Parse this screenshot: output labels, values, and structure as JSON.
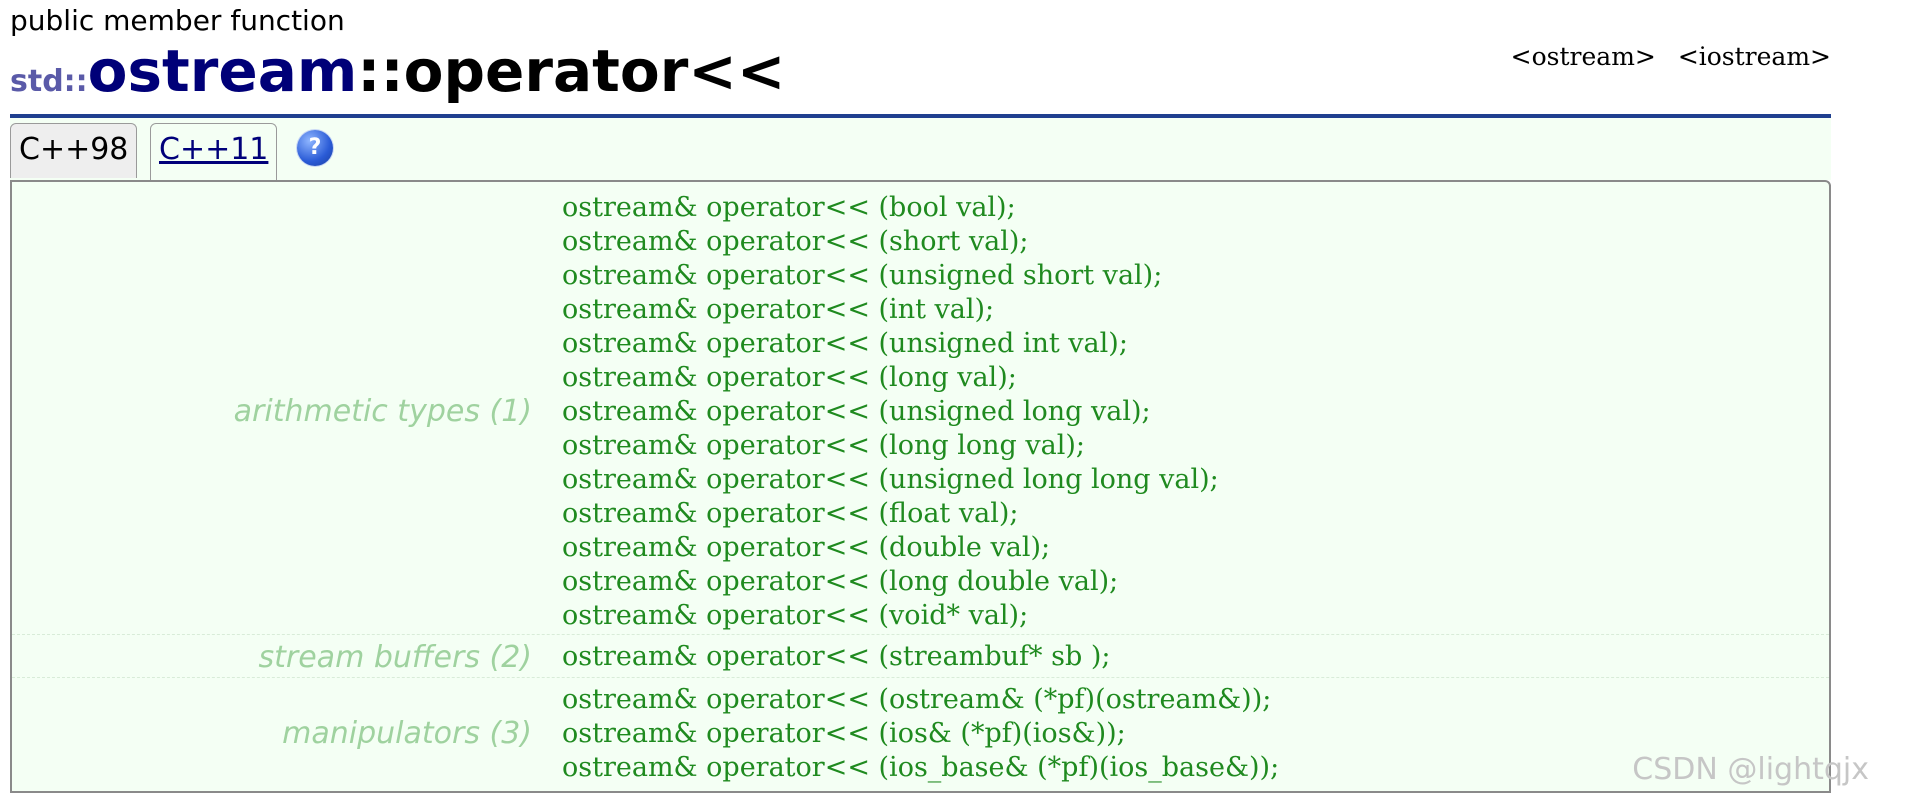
{
  "page": {
    "kind": "public member function",
    "title": {
      "namespace": "std::",
      "class_name": "ostream",
      "separator": "::",
      "function": "operator<<"
    },
    "headers": [
      "<ostream>",
      "<iostream>"
    ]
  },
  "tabs": [
    {
      "label": "C++98",
      "selected": false
    },
    {
      "label": "C++11",
      "selected": true
    }
  ],
  "help": {
    "glyph": "?",
    "icon": "help-icon"
  },
  "groups": [
    {
      "label": "arithmetic types (1)",
      "lines": [
        "ostream& operator<< (bool val);",
        "ostream& operator<< (short val);",
        "ostream& operator<< (unsigned short val);",
        "ostream& operator<< (int val);",
        "ostream& operator<< (unsigned int val);",
        "ostream& operator<< (long val);",
        "ostream& operator<< (unsigned long val);",
        "ostream& operator<< (long long val);",
        "ostream& operator<< (unsigned long long val);",
        "ostream& operator<< (float val);",
        "ostream& operator<< (double val);",
        "ostream& operator<< (long double val);",
        "ostream& operator<< (void* val);"
      ]
    },
    {
      "label": "stream buffers (2)",
      "lines": [
        "ostream& operator<< (streambuf* sb );"
      ]
    },
    {
      "label": "manipulators (3)",
      "lines": [
        "ostream& operator<< (ostream& (*pf)(ostream&));",
        "ostream& operator<< (ios& (*pf)(ios&));",
        "ostream& operator<< (ios_base& (*pf)(ios_base&));"
      ]
    }
  ],
  "watermark": "CSDN @lightqjx",
  "colors": {
    "rule": "#1f3f8f",
    "panel_background": "#f4fff4",
    "code_text": "#1f8a1f",
    "group_label": "#9fd29f",
    "class_name": "#000078",
    "namespace": "#5a5aa8"
  }
}
